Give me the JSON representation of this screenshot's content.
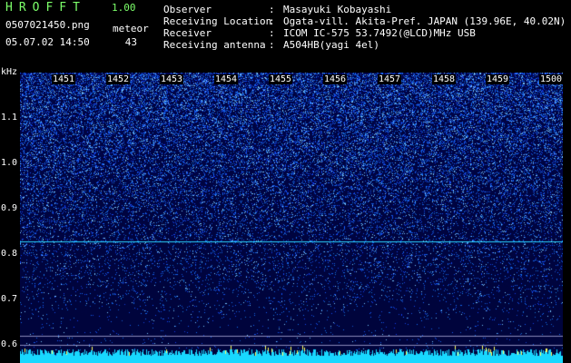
{
  "header": {
    "app_name": "HROFFT",
    "version": "1.00",
    "filename": "0507021450.png",
    "meteor_label": "meteor",
    "datetime": "05.07.02 14:50",
    "meteor_count": "43"
  },
  "info": [
    {
      "label": "Observer",
      "sep": ":",
      "value": "Masayuki Kobayashi"
    },
    {
      "label": "Receiving Location",
      "sep": ":",
      "value": "Ogata-vill. Akita-Pref. JAPAN (139.96E, 40.02N)"
    },
    {
      "label": "Receiver",
      "sep": ":",
      "value": "ICOM IC-575 53.7492(@LCD)MHz USB"
    },
    {
      "label": "Receiving antenna",
      "sep": ":",
      "value": "A504HB(yagi 4el)"
    }
  ],
  "axis": {
    "unit": "kHz",
    "y_labels": [
      "1.1",
      "1.0",
      "0.9",
      "0.8",
      "0.7",
      "0.6"
    ],
    "time_ticks": [
      "1451",
      "1452",
      "1453",
      "1454",
      "1455",
      "1456",
      "1457",
      "1458",
      "1459",
      "1500"
    ]
  },
  "colors": {
    "title": "#7cff6a",
    "background": "#000000",
    "spectrogram_base": "#00064e",
    "carrier_line": "#2ad4ff",
    "bottom_band": "#18d8ff"
  }
}
